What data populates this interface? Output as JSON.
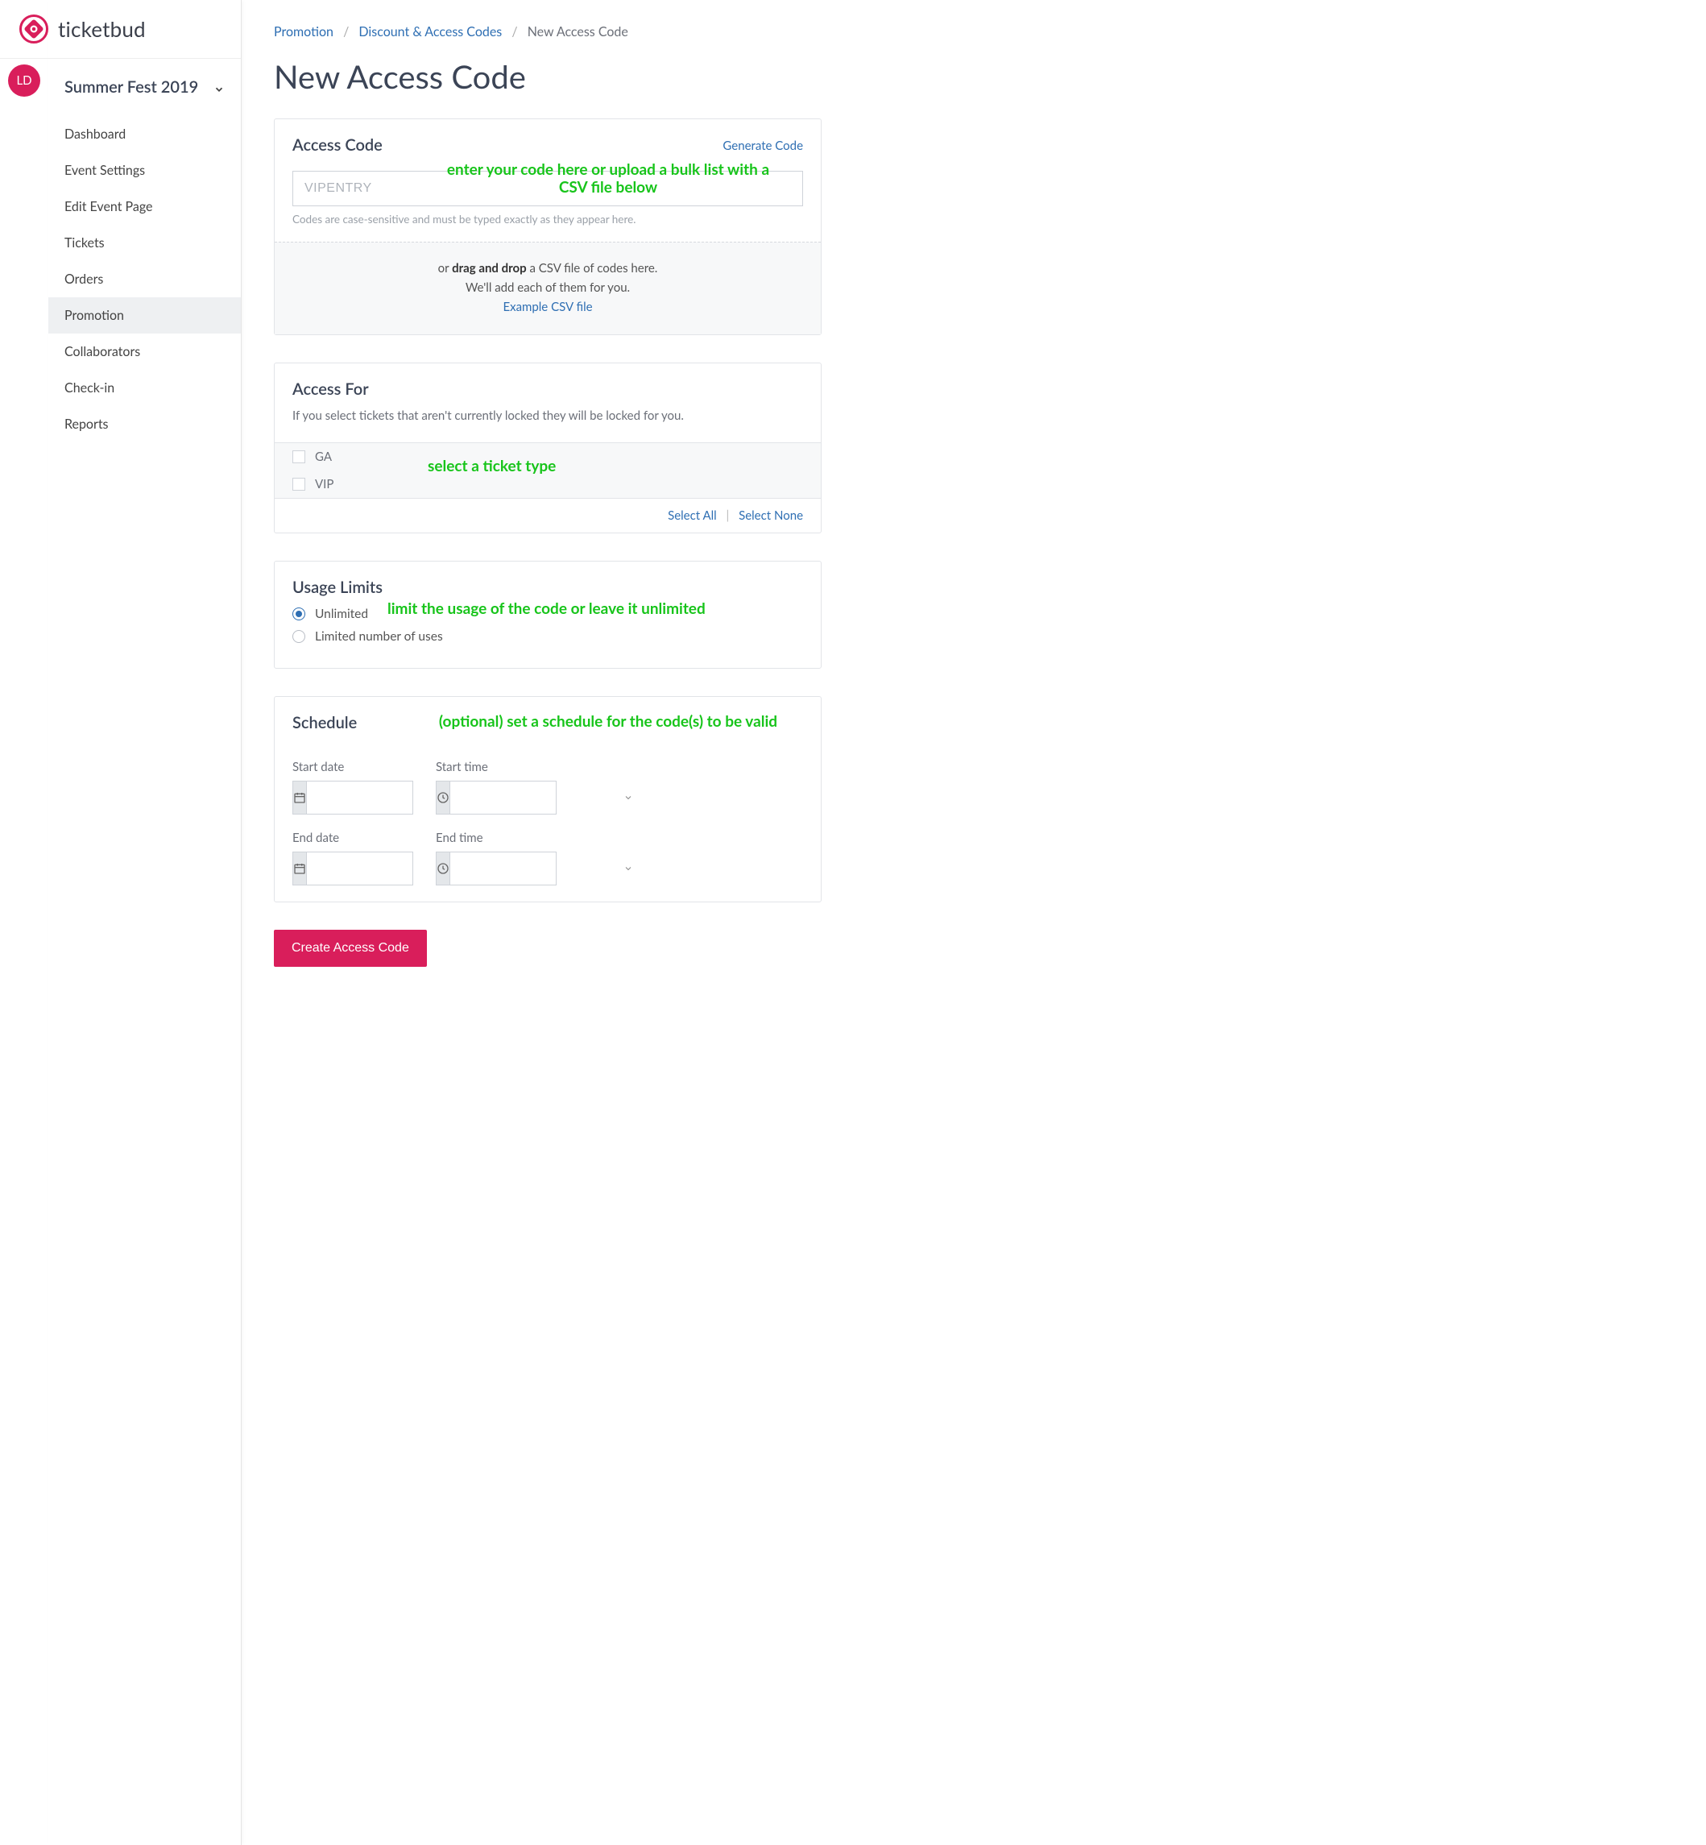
{
  "brand": {
    "name": "ticketbud"
  },
  "avatar": {
    "initials": "LD"
  },
  "event_switcher": {
    "name": "Summer Fest 2019"
  },
  "sidebar": {
    "items": [
      {
        "label": "Dashboard"
      },
      {
        "label": "Event Settings"
      },
      {
        "label": "Edit Event Page"
      },
      {
        "label": "Tickets"
      },
      {
        "label": "Orders"
      },
      {
        "label": "Promotion",
        "active": true
      },
      {
        "label": "Collaborators"
      },
      {
        "label": "Check-in"
      },
      {
        "label": "Reports"
      }
    ]
  },
  "breadcrumb": {
    "promotion": "Promotion",
    "discount": "Discount & Access Codes",
    "current": "New Access Code"
  },
  "page": {
    "title": "New Access Code"
  },
  "access_code": {
    "heading": "Access Code",
    "generate_link": "Generate Code",
    "placeholder": "VIPENTRY",
    "helper": "Codes are case-sensitive and must be typed exactly as they appear here.",
    "drop_pre": "or ",
    "drop_strong": "drag and drop",
    "drop_post": " a CSV file of codes here.",
    "drop_line2": "We'll add each of them for you.",
    "example_link": "Example CSV file"
  },
  "access_for": {
    "heading": "Access For",
    "subtext": "If you select tickets that aren't currently locked they will be locked for you.",
    "tickets": [
      {
        "label": "GA",
        "checked": false
      },
      {
        "label": "VIP",
        "checked": false
      }
    ],
    "select_all": "Select All",
    "select_none": "Select None"
  },
  "usage": {
    "heading": "Usage Limits",
    "options": [
      {
        "label": "Unlimited",
        "checked": true
      },
      {
        "label": "Limited number of uses",
        "checked": false
      }
    ]
  },
  "schedule": {
    "heading": "Schedule",
    "start_date_label": "Start date",
    "start_time_label": "Start time",
    "end_date_label": "End date",
    "end_time_label": "End time"
  },
  "submit": {
    "label": "Create Access Code"
  },
  "annotations": {
    "code": "enter your code here or upload a bulk list with a CSV file below",
    "ticket": "select a ticket type",
    "usage": "limit the usage of the code or leave it unlimited",
    "schedule": "(optional) set a schedule for the code(s) to be valid"
  }
}
